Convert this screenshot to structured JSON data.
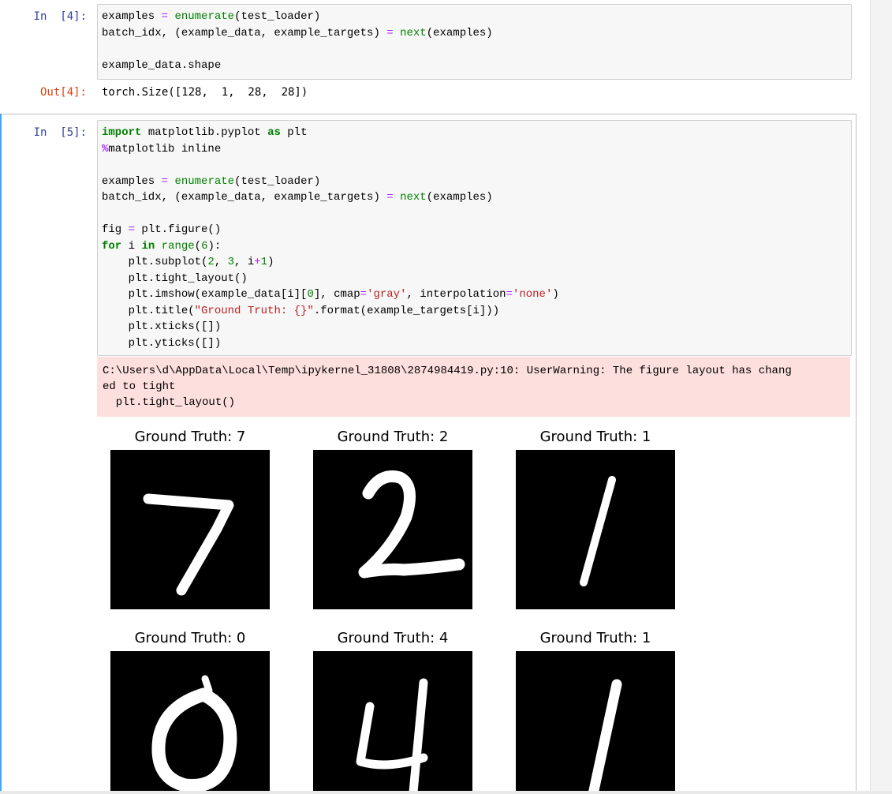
{
  "cell4": {
    "in_prompt": "In  [4]:",
    "code_lines": [
      "examples = enumerate(test_loader)",
      "batch_idx, (example_data, example_targets) = next(examples)",
      "",
      "example_data.shape"
    ],
    "out_prompt": "Out[4]:",
    "output": "torch.Size([128,  1,  28,  28])"
  },
  "cell5": {
    "in_prompt": "In  [5]:",
    "code_lines": [
      "import matplotlib.pyplot as plt",
      "%matplotlib inline",
      "",
      "examples = enumerate(test_loader)",
      "batch_idx, (example_data, example_targets) = next(examples)",
      "",
      "fig = plt.figure()",
      "for i in range(6):",
      "    plt.subplot(2, 3, i+1)",
      "    plt.tight_layout()",
      "    plt.imshow(example_data[i][0], cmap='gray', interpolation='none')",
      "    plt.title(\"Ground Truth: {}\".format(example_targets[i]))",
      "    plt.xticks([])",
      "    plt.yticks([])"
    ],
    "stderr_lines": [
      "C:\\Users\\d\\AppData\\Local\\Temp\\ipykernel_31808\\2874984419.py:10: UserWarning: The figure layout has chang",
      "ed to tight",
      "  plt.tight_layout()"
    ],
    "figures": [
      {
        "title": "Ground Truth: 7",
        "digit": "7"
      },
      {
        "title": "Ground Truth: 2",
        "digit": "2"
      },
      {
        "title": "Ground Truth: 1",
        "digit": "1"
      },
      {
        "title": "Ground Truth: 0",
        "digit": "0"
      },
      {
        "title": "Ground Truth: 4",
        "digit": "4"
      },
      {
        "title": "Ground Truth: 1",
        "digit": "1"
      }
    ]
  },
  "colors": {
    "prompt_in": "#303f9f",
    "prompt_out": "#d84315",
    "keyword": "#008000",
    "string": "#ba2121",
    "stderr_bg": "#fddfdd",
    "selected_cell": "#42a5f5"
  }
}
